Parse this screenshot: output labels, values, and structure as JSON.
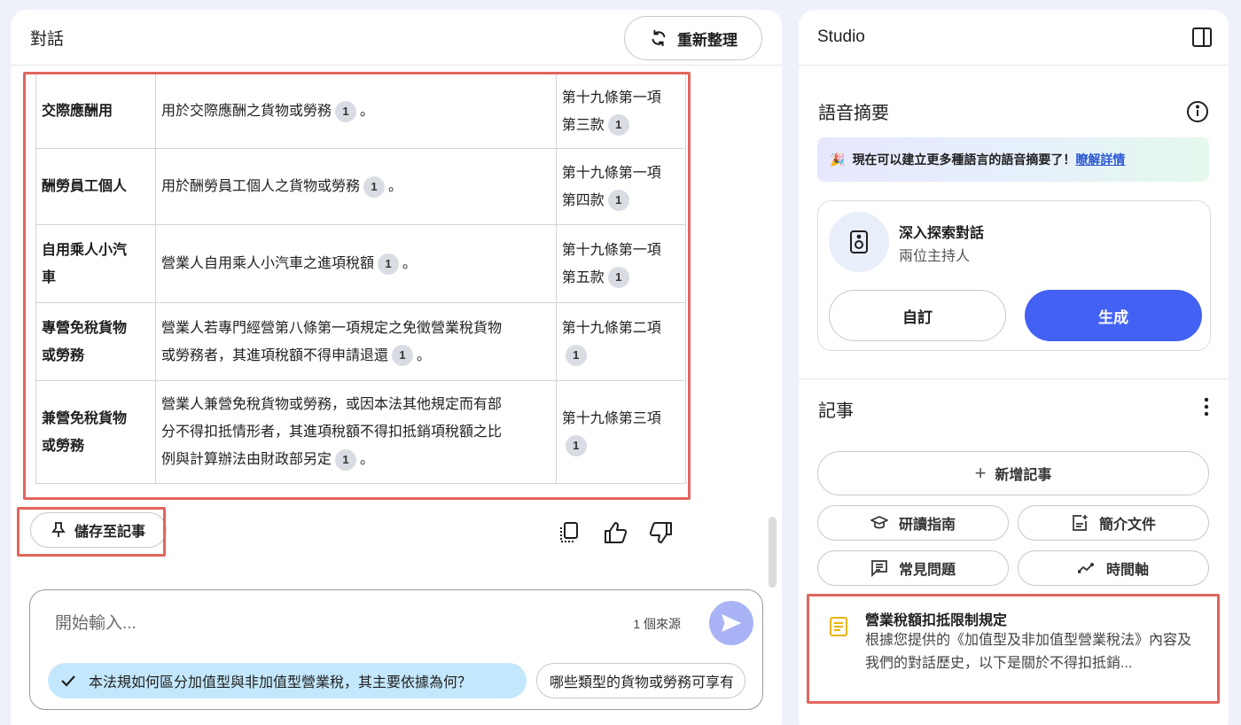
{
  "chat": {
    "title": "對話",
    "refresh_label": "重新整理",
    "table_rows": [
      {
        "label": "交際應酬用",
        "description": "用於交際應酬之貨物或勞務",
        "citation": "1",
        "article_line1": "第十九條第一項",
        "article_line2": "第三款",
        "article_citation": "1"
      },
      {
        "label": "酬勞員工個人",
        "description": "用於酬勞員工個人之貨物或勞務",
        "citation": "1",
        "article_line1": "第十九條第一項",
        "article_line2": "第四款",
        "article_citation": "1"
      },
      {
        "label_line1": "自用乘人小汽",
        "label_line2": "車",
        "description": "營業人自用乘人小汽車之進項稅額",
        "citation": "1",
        "article_line1": "第十九條第一項",
        "article_line2": "第五款",
        "article_citation": "1"
      },
      {
        "label_line1": "專營免稅貨物",
        "label_line2": "或勞務",
        "description_line1": "營業人若專門經營第八條第一項規定之免徵營業稅貨物",
        "description_line2": "或勞務者，其進項稅額不得申請退還",
        "citation": "1",
        "article_line1": "第十九條第二項",
        "article_citation": "1"
      },
      {
        "label_line1": "兼營免稅貨物",
        "label_line2": "或勞務",
        "description_line1": "營業人兼營免稅貨物或勞務，或因本法其他規定而有部",
        "description_line2": "分不得扣抵情形者，其進項稅額不得扣抵銷項稅額之比",
        "description_line3": "例與計算辦法由財政部另定",
        "citation": "1",
        "article_line1": "第十九條第三項",
        "article_citation": "1"
      }
    ],
    "save_note_label": "儲存至記事",
    "composer": {
      "placeholder": "開始輸入...",
      "source_count": "1 個來源",
      "suggestions": [
        "本法規如何區分加值型與非加值型營業稅，其主要依據為何？",
        "哪些類型的貨物或勞務可享有"
      ]
    }
  },
  "studio": {
    "title": "Studio",
    "audio_section_title": "語音摘要",
    "banner_emoji": "🎉",
    "banner_text": "現在可以建立更多種語言的語音摘要了！",
    "banner_link": "瞭解詳情",
    "audio_card": {
      "name": "深入探索對話",
      "subtitle": "兩位主持人",
      "customize_label": "自訂",
      "generate_label": "生成"
    },
    "notes_section_title": "記事",
    "add_note_label": "新增記事",
    "chips": [
      "研讀指南",
      "簡介文件",
      "常見問題",
      "時間軸"
    ],
    "note": {
      "title": "營業稅額扣抵限制規定",
      "body": "根據您提供的《加值型及非加值型營業稅法》內容及我們的對話歷史，以下是關於不得扣抵銷..."
    }
  },
  "colors": {
    "background": "#eef0fa",
    "accent_blue": "#4361f2",
    "highlight_red": "#e0655e",
    "suggestion_blue": "#c3e7fc"
  },
  "icons": [
    "refresh-icon",
    "pin-icon",
    "copy-icon",
    "thumbs-up-icon",
    "thumbs-down-icon",
    "send-icon",
    "check-icon",
    "panel-toggle-icon",
    "info-icon",
    "speaker-icon",
    "more-vert-icon",
    "plus-icon",
    "graduation-cap-icon",
    "document-icon",
    "faq-icon",
    "timeline-icon",
    "note-icon"
  ]
}
